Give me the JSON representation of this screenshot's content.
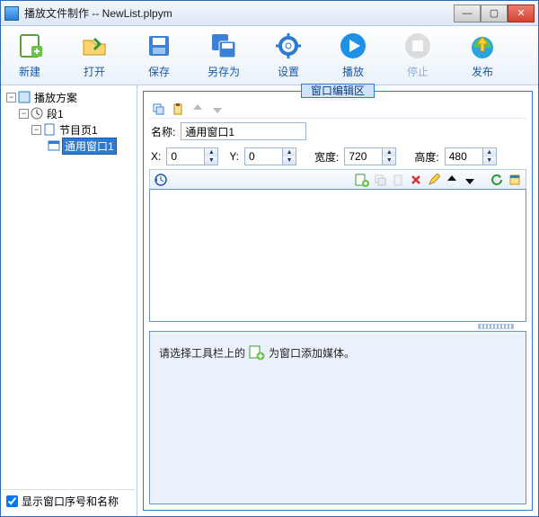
{
  "window": {
    "title": "播放文件制作  --  NewList.plpym"
  },
  "toolbar": {
    "new": "新建",
    "open": "打开",
    "save": "保存",
    "saveas": "另存为",
    "settings": "设置",
    "play": "播放",
    "stop": "停止",
    "publish": "发布"
  },
  "tree": {
    "root": "播放方案",
    "seg": "段1",
    "page": "节目页1",
    "win": "通用窗口1"
  },
  "checkbox": {
    "label": "显示窗口序号和名称",
    "checked": true
  },
  "group": {
    "title": "窗口编辑区"
  },
  "fields": {
    "name_label": "名称:",
    "name_value": "通用窗口1",
    "x_label": "X:",
    "x_value": "0",
    "y_label": "Y:",
    "y_value": "0",
    "w_label": "宽度:",
    "w_value": "720",
    "h_label": "高度:",
    "h_value": "480"
  },
  "hint": {
    "pre": "请选择工具栏上的",
    "post": "为窗口添加媒体。"
  }
}
